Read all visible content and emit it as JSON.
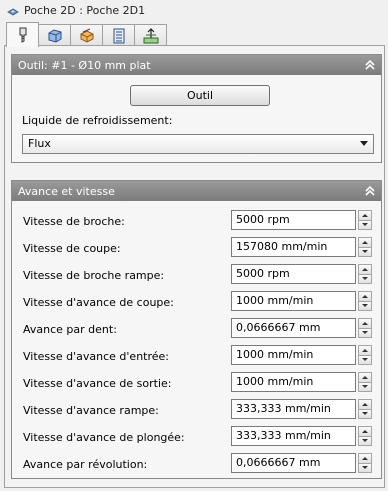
{
  "window": {
    "title": "Poche 2D : Poche 2D1"
  },
  "icons": {
    "app": "pocket-app-icon",
    "tabs": [
      "tool-tab-icon",
      "geometry-tab-icon",
      "heights-tab-icon",
      "passes-tab-icon",
      "linking-tab-icon"
    ],
    "collapse": "double-chevron-up-icon"
  },
  "tool_panel": {
    "header": "Outil: #1 - Ø10 mm plat",
    "tool_button": "Outil",
    "coolant_label": "Liquide de refroidissement:",
    "coolant_value": "Flux"
  },
  "feed_panel": {
    "header": "Avance et vitesse",
    "rows": [
      {
        "label": "Vitesse de broche:",
        "value": "5000 rpm"
      },
      {
        "label": "Vitesse de coupe:",
        "value": "157080 mm/min"
      },
      {
        "label": "Vitesse de broche rampe:",
        "value": "5000 rpm"
      },
      {
        "label": "Vitesse d'avance de coupe:",
        "value": "1000 mm/min"
      },
      {
        "label": "Avance par dent:",
        "value": "0,0666667 mm"
      },
      {
        "label": "Vitesse d'avance d'entrée:",
        "value": "1000 mm/min"
      },
      {
        "label": "Vitesse d'avance de sortie:",
        "value": "1000 mm/min"
      },
      {
        "label": "Vitesse d'avance rampe:",
        "value": "333,333 mm/min"
      },
      {
        "label": "Vitesse d'avance de plongée:",
        "value": "333,333 mm/min"
      },
      {
        "label": "Avance par révolution:",
        "value": "0,0666667 mm"
      }
    ]
  }
}
